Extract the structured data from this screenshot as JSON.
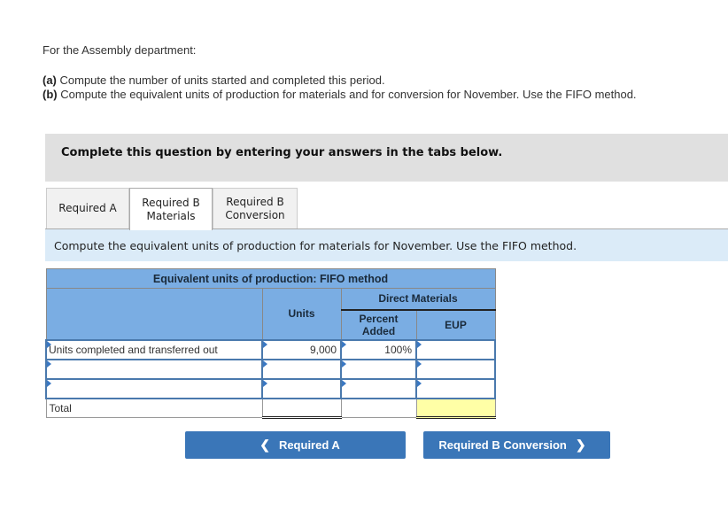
{
  "intro": "For the Assembly department:",
  "questions": [
    {
      "tag": "(a)",
      "text": " Compute the number of units started and completed this period."
    },
    {
      "tag": "(b)",
      "text": " Compute the equivalent units of production for materials and for conversion for November. Use the FIFO method."
    }
  ],
  "banner": "Complete this question by entering your answers in the tabs below.",
  "tabs": [
    {
      "label": "Required A",
      "active": false
    },
    {
      "label": "Required B Materials",
      "active": true
    },
    {
      "label": "Required B Conversion",
      "active": false
    }
  ],
  "instruction": "Compute the equivalent units of production for materials for November. Use the FIFO method.",
  "table": {
    "title": "Equivalent units of production: FIFO method",
    "col_units": "Units",
    "group_header": "Direct Materials",
    "col_percent": "Percent Added",
    "col_eup": "EUP",
    "rows": [
      {
        "label": "Units completed and transferred out",
        "units": "9,000",
        "percent": "100%",
        "eup": ""
      },
      {
        "label": "",
        "units": "",
        "percent": "",
        "eup": ""
      },
      {
        "label": "",
        "units": "",
        "percent": "",
        "eup": ""
      }
    ],
    "total_label": "Total",
    "total_units": "",
    "total_eup": ""
  },
  "nav": {
    "prev_label": "Required A",
    "next_label": "Required B Conversion",
    "prev_icon": "chevron-left-icon",
    "next_icon": "chevron-right-icon"
  }
}
